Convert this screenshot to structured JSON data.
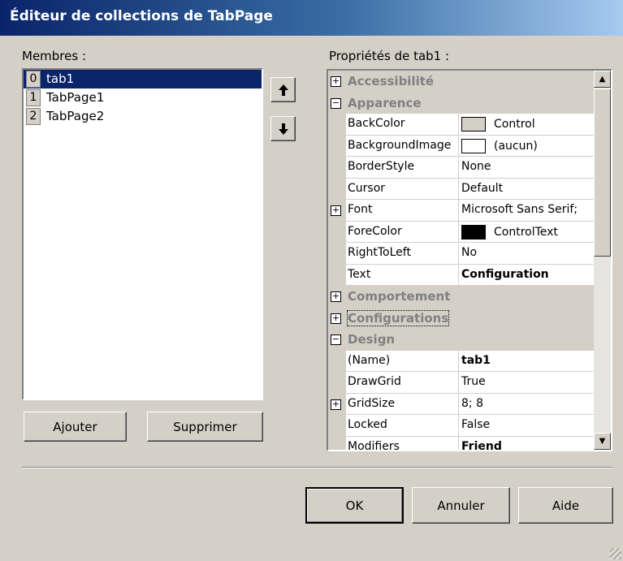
{
  "window": {
    "title": "Éditeur de collections de TabPage"
  },
  "members": {
    "label": "Membres :",
    "items": [
      {
        "index": "0",
        "name": "tab1",
        "selected": true
      },
      {
        "index": "1",
        "name": "TabPage1",
        "selected": false
      },
      {
        "index": "2",
        "name": "TabPage2",
        "selected": false
      }
    ],
    "move_up_icon": "up-arrow-icon",
    "move_down_icon": "down-arrow-icon",
    "add_label": "Ajouter",
    "remove_label": "Supprimer"
  },
  "properties": {
    "label": "Propriétés de tab1 :",
    "rows": [
      {
        "type": "category",
        "name": "Accessibilité",
        "expander": "+"
      },
      {
        "type": "category",
        "name": "Apparence",
        "expander": "−"
      },
      {
        "type": "property",
        "name": "BackColor",
        "value": "Control",
        "swatch": "#d4d0c8"
      },
      {
        "type": "property",
        "name": "BackgroundImage",
        "value": "(aucun)",
        "swatch": "#ffffff"
      },
      {
        "type": "property",
        "name": "BorderStyle",
        "value": "None"
      },
      {
        "type": "property",
        "name": "Cursor",
        "value": "Default"
      },
      {
        "type": "property",
        "name": "Font",
        "value": "Microsoft Sans Serif;",
        "expander": "+"
      },
      {
        "type": "property",
        "name": "ForeColor",
        "value": "ControlText",
        "swatch": "#000000"
      },
      {
        "type": "property",
        "name": "RightToLeft",
        "value": "No"
      },
      {
        "type": "property",
        "name": "Text",
        "value": "Configuration",
        "bold": true
      },
      {
        "type": "category",
        "name": "Comportement",
        "expander": "+"
      },
      {
        "type": "category",
        "name": "Configurations",
        "expander": "+",
        "focused": true
      },
      {
        "type": "category",
        "name": "Design",
        "expander": "−"
      },
      {
        "type": "property",
        "name": "(Name)",
        "value": "tab1",
        "bold": true
      },
      {
        "type": "property",
        "name": "DrawGrid",
        "value": "True"
      },
      {
        "type": "property",
        "name": "GridSize",
        "value": "8; 8",
        "expander": "+"
      },
      {
        "type": "property",
        "name": "Locked",
        "value": "False"
      },
      {
        "type": "property",
        "name": "Modifiers",
        "value": "Friend",
        "bold": true
      }
    ]
  },
  "footer": {
    "ok_label": "OK",
    "cancel_label": "Annuler",
    "help_label": "Aide"
  }
}
